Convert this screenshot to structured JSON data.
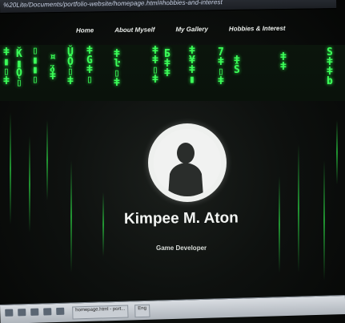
{
  "browser": {
    "url": "%20Lite/Documents/portfolio-website/homepage.html#hobbies-and-interest"
  },
  "nav": [
    {
      "label": "Home"
    },
    {
      "label": "About Myself"
    },
    {
      "label": "My Gallery"
    },
    {
      "label": "Hobbies & Interest"
    }
  ],
  "hero": {
    "name": "Kimpee M. Aton",
    "role": "Game Developer"
  },
  "taskbar": {
    "items": [
      {
        "label": "homepage.html - port..."
      },
      {
        "label": "Eng"
      }
    ]
  },
  "colors": {
    "matrix_green": "#3cff5a",
    "background": "#0e110f",
    "nav_text": "#e9ece9"
  }
}
